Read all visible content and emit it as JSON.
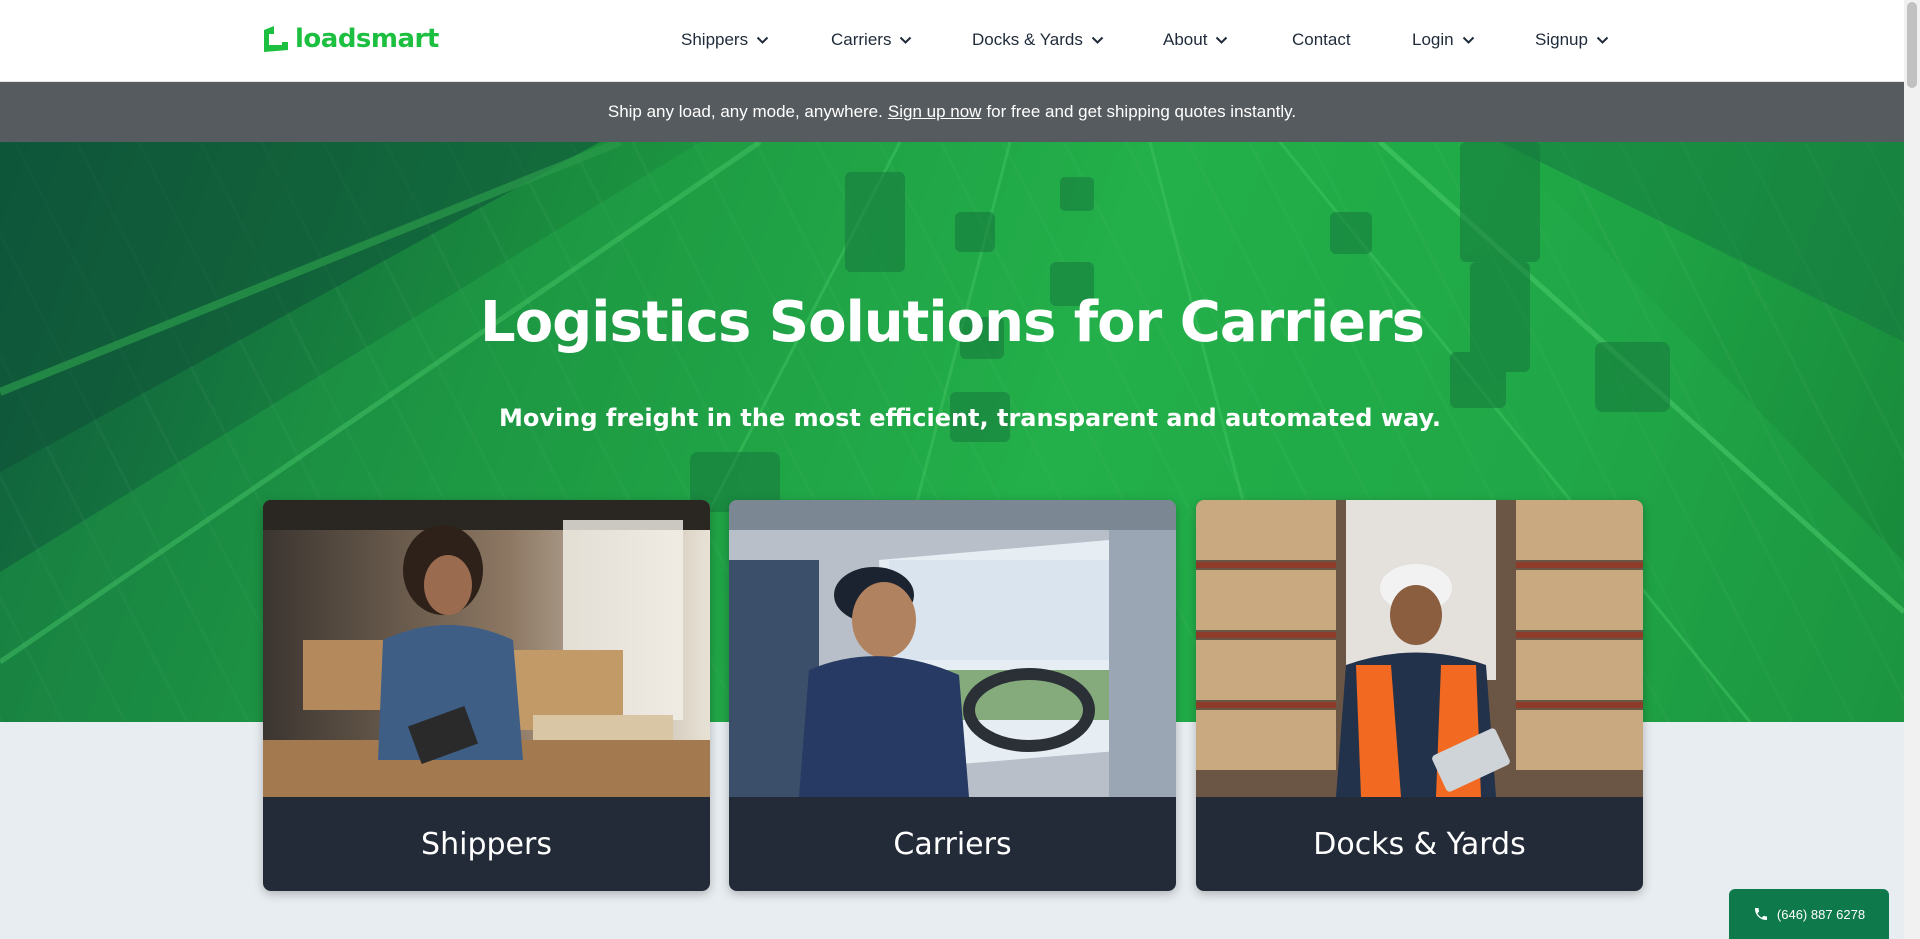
{
  "brand": {
    "name": "loadsmart",
    "color": "#1cbf3f",
    "logo_icon": "loadsmart-logo-icon"
  },
  "nav": [
    {
      "label": "Shippers",
      "dropdown": true
    },
    {
      "label": "Carriers",
      "dropdown": true
    },
    {
      "label": "Docks & Yards",
      "dropdown": true
    },
    {
      "label": "About",
      "dropdown": true
    },
    {
      "label": "Contact",
      "dropdown": false
    },
    {
      "label": "Login",
      "dropdown": true
    },
    {
      "label": "Signup",
      "dropdown": true
    }
  ],
  "announcement": {
    "before": "Ship any load, any mode, anywhere.",
    "link": "Sign up now",
    "after": "for free and get shipping quotes instantly."
  },
  "hero": {
    "title": "Logistics Solutions for Carriers",
    "subtitle": "Moving freight in the most efficient, transparent and automated way."
  },
  "cards": [
    {
      "label": "Shippers",
      "image": "woman-with-tablet-among-boxes-photo"
    },
    {
      "label": "Carriers",
      "image": "truck-driver-at-wheel-photo"
    },
    {
      "label": "Docks & Yards",
      "image": "warehouse-worker-with-tablet-photo"
    }
  ],
  "phone": {
    "number": "(646) 887 6278",
    "icon": "phone-icon"
  },
  "colors": {
    "announcement_bg": "#565b5f",
    "card_bg": "#232b38",
    "phone_bg": "#0e7a4c",
    "page_bg": "#e8edf1"
  }
}
